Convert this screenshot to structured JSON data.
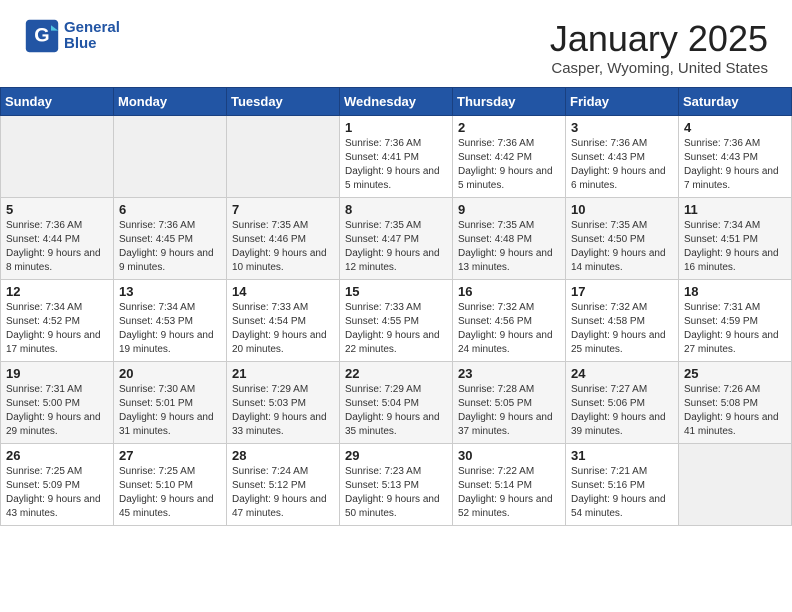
{
  "header": {
    "logo_line1": "General",
    "logo_line2": "Blue",
    "month": "January 2025",
    "location": "Casper, Wyoming, United States"
  },
  "weekdays": [
    "Sunday",
    "Monday",
    "Tuesday",
    "Wednesday",
    "Thursday",
    "Friday",
    "Saturday"
  ],
  "weeks": [
    [
      {
        "day": "",
        "sunrise": "",
        "sunset": "",
        "daylight": ""
      },
      {
        "day": "",
        "sunrise": "",
        "sunset": "",
        "daylight": ""
      },
      {
        "day": "",
        "sunrise": "",
        "sunset": "",
        "daylight": ""
      },
      {
        "day": "1",
        "sunrise": "Sunrise: 7:36 AM",
        "sunset": "Sunset: 4:41 PM",
        "daylight": "Daylight: 9 hours and 5 minutes."
      },
      {
        "day": "2",
        "sunrise": "Sunrise: 7:36 AM",
        "sunset": "Sunset: 4:42 PM",
        "daylight": "Daylight: 9 hours and 5 minutes."
      },
      {
        "day": "3",
        "sunrise": "Sunrise: 7:36 AM",
        "sunset": "Sunset: 4:43 PM",
        "daylight": "Daylight: 9 hours and 6 minutes."
      },
      {
        "day": "4",
        "sunrise": "Sunrise: 7:36 AM",
        "sunset": "Sunset: 4:43 PM",
        "daylight": "Daylight: 9 hours and 7 minutes."
      }
    ],
    [
      {
        "day": "5",
        "sunrise": "Sunrise: 7:36 AM",
        "sunset": "Sunset: 4:44 PM",
        "daylight": "Daylight: 9 hours and 8 minutes."
      },
      {
        "day": "6",
        "sunrise": "Sunrise: 7:36 AM",
        "sunset": "Sunset: 4:45 PM",
        "daylight": "Daylight: 9 hours and 9 minutes."
      },
      {
        "day": "7",
        "sunrise": "Sunrise: 7:35 AM",
        "sunset": "Sunset: 4:46 PM",
        "daylight": "Daylight: 9 hours and 10 minutes."
      },
      {
        "day": "8",
        "sunrise": "Sunrise: 7:35 AM",
        "sunset": "Sunset: 4:47 PM",
        "daylight": "Daylight: 9 hours and 12 minutes."
      },
      {
        "day": "9",
        "sunrise": "Sunrise: 7:35 AM",
        "sunset": "Sunset: 4:48 PM",
        "daylight": "Daylight: 9 hours and 13 minutes."
      },
      {
        "day": "10",
        "sunrise": "Sunrise: 7:35 AM",
        "sunset": "Sunset: 4:50 PM",
        "daylight": "Daylight: 9 hours and 14 minutes."
      },
      {
        "day": "11",
        "sunrise": "Sunrise: 7:34 AM",
        "sunset": "Sunset: 4:51 PM",
        "daylight": "Daylight: 9 hours and 16 minutes."
      }
    ],
    [
      {
        "day": "12",
        "sunrise": "Sunrise: 7:34 AM",
        "sunset": "Sunset: 4:52 PM",
        "daylight": "Daylight: 9 hours and 17 minutes."
      },
      {
        "day": "13",
        "sunrise": "Sunrise: 7:34 AM",
        "sunset": "Sunset: 4:53 PM",
        "daylight": "Daylight: 9 hours and 19 minutes."
      },
      {
        "day": "14",
        "sunrise": "Sunrise: 7:33 AM",
        "sunset": "Sunset: 4:54 PM",
        "daylight": "Daylight: 9 hours and 20 minutes."
      },
      {
        "day": "15",
        "sunrise": "Sunrise: 7:33 AM",
        "sunset": "Sunset: 4:55 PM",
        "daylight": "Daylight: 9 hours and 22 minutes."
      },
      {
        "day": "16",
        "sunrise": "Sunrise: 7:32 AM",
        "sunset": "Sunset: 4:56 PM",
        "daylight": "Daylight: 9 hours and 24 minutes."
      },
      {
        "day": "17",
        "sunrise": "Sunrise: 7:32 AM",
        "sunset": "Sunset: 4:58 PM",
        "daylight": "Daylight: 9 hours and 25 minutes."
      },
      {
        "day": "18",
        "sunrise": "Sunrise: 7:31 AM",
        "sunset": "Sunset: 4:59 PM",
        "daylight": "Daylight: 9 hours and 27 minutes."
      }
    ],
    [
      {
        "day": "19",
        "sunrise": "Sunrise: 7:31 AM",
        "sunset": "Sunset: 5:00 PM",
        "daylight": "Daylight: 9 hours and 29 minutes."
      },
      {
        "day": "20",
        "sunrise": "Sunrise: 7:30 AM",
        "sunset": "Sunset: 5:01 PM",
        "daylight": "Daylight: 9 hours and 31 minutes."
      },
      {
        "day": "21",
        "sunrise": "Sunrise: 7:29 AM",
        "sunset": "Sunset: 5:03 PM",
        "daylight": "Daylight: 9 hours and 33 minutes."
      },
      {
        "day": "22",
        "sunrise": "Sunrise: 7:29 AM",
        "sunset": "Sunset: 5:04 PM",
        "daylight": "Daylight: 9 hours and 35 minutes."
      },
      {
        "day": "23",
        "sunrise": "Sunrise: 7:28 AM",
        "sunset": "Sunset: 5:05 PM",
        "daylight": "Daylight: 9 hours and 37 minutes."
      },
      {
        "day": "24",
        "sunrise": "Sunrise: 7:27 AM",
        "sunset": "Sunset: 5:06 PM",
        "daylight": "Daylight: 9 hours and 39 minutes."
      },
      {
        "day": "25",
        "sunrise": "Sunrise: 7:26 AM",
        "sunset": "Sunset: 5:08 PM",
        "daylight": "Daylight: 9 hours and 41 minutes."
      }
    ],
    [
      {
        "day": "26",
        "sunrise": "Sunrise: 7:25 AM",
        "sunset": "Sunset: 5:09 PM",
        "daylight": "Daylight: 9 hours and 43 minutes."
      },
      {
        "day": "27",
        "sunrise": "Sunrise: 7:25 AM",
        "sunset": "Sunset: 5:10 PM",
        "daylight": "Daylight: 9 hours and 45 minutes."
      },
      {
        "day": "28",
        "sunrise": "Sunrise: 7:24 AM",
        "sunset": "Sunset: 5:12 PM",
        "daylight": "Daylight: 9 hours and 47 minutes."
      },
      {
        "day": "29",
        "sunrise": "Sunrise: 7:23 AM",
        "sunset": "Sunset: 5:13 PM",
        "daylight": "Daylight: 9 hours and 50 minutes."
      },
      {
        "day": "30",
        "sunrise": "Sunrise: 7:22 AM",
        "sunset": "Sunset: 5:14 PM",
        "daylight": "Daylight: 9 hours and 52 minutes."
      },
      {
        "day": "31",
        "sunrise": "Sunrise: 7:21 AM",
        "sunset": "Sunset: 5:16 PM",
        "daylight": "Daylight: 9 hours and 54 minutes."
      },
      {
        "day": "",
        "sunrise": "",
        "sunset": "",
        "daylight": ""
      }
    ]
  ]
}
